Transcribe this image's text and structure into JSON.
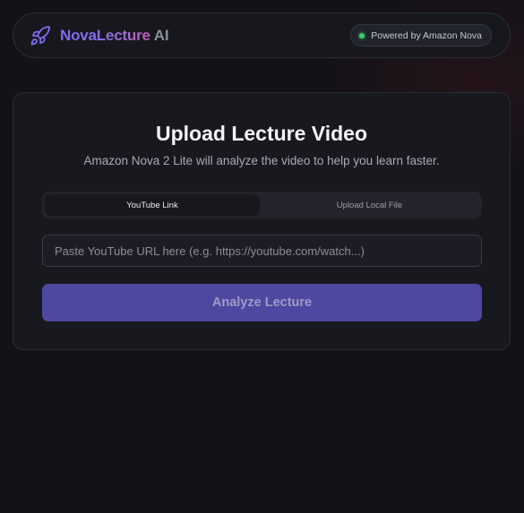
{
  "header": {
    "brand_main": "NovaLecture",
    "brand_suffix": "AI",
    "logo_icon": "rocket-icon",
    "badge_text": "Powered by Amazon Nova",
    "badge_status_color": "#3ecb77"
  },
  "upload": {
    "title": "Upload Lecture Video",
    "subtitle": "Amazon Nova 2 Lite will analyze the video to help you learn faster.",
    "tabs": [
      {
        "label": "YouTube Link",
        "active": true
      },
      {
        "label": "Upload Local File",
        "active": false
      }
    ],
    "url_input": {
      "value": "",
      "placeholder": "Paste YouTube URL here (e.g. https://youtube.com/watch...)"
    },
    "analyze_label": "Analyze Lecture"
  },
  "colors": {
    "background": "#121217",
    "accent": "#4f48a0",
    "brand_gradient": [
      "#7b6cf2",
      "#c260b8"
    ]
  }
}
